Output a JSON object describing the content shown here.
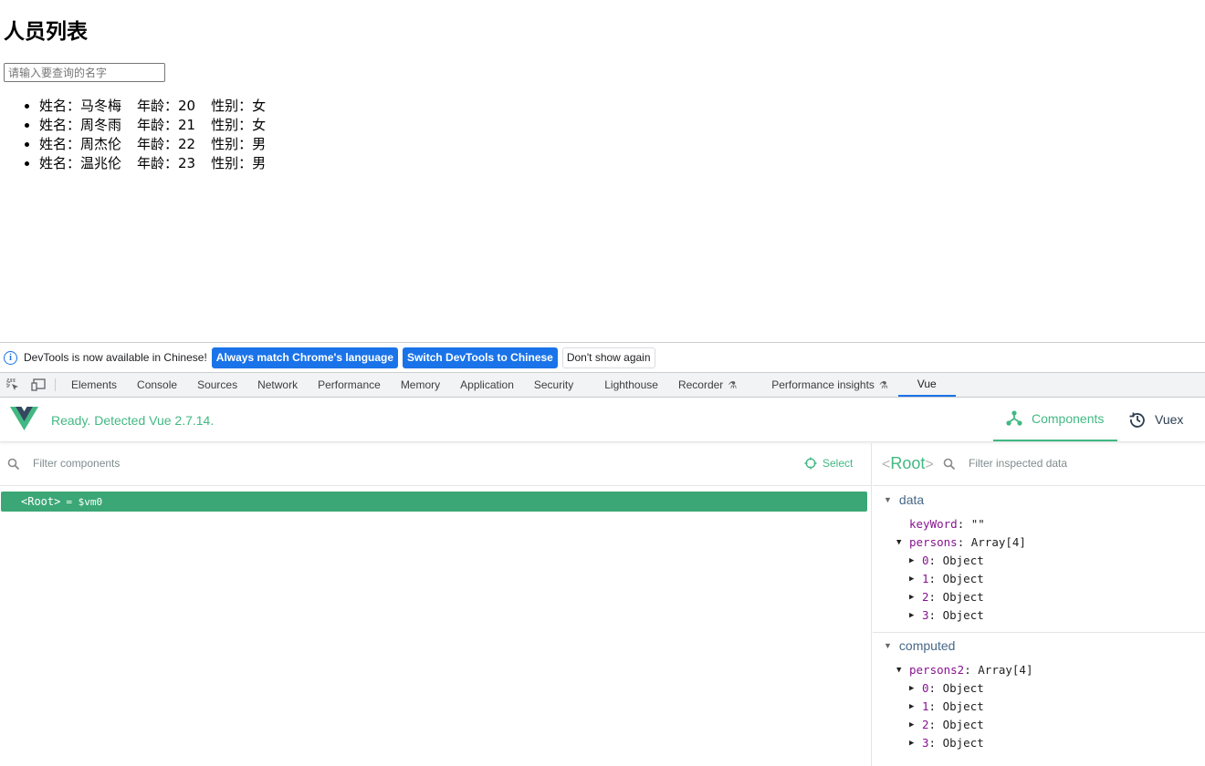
{
  "page": {
    "title": "人员列表",
    "search_placeholder": "请输入要查询的名字",
    "persons": [
      {
        "name": "姓名：马冬梅",
        "age": "年龄：20",
        "sex": "性别：女"
      },
      {
        "name": "姓名：周冬雨",
        "age": "年龄：21",
        "sex": "性别：女"
      },
      {
        "name": "姓名：周杰伦",
        "age": "年龄：22",
        "sex": "性别：男"
      },
      {
        "name": "姓名：温兆伦",
        "age": "年龄：23",
        "sex": "性别：男"
      }
    ]
  },
  "infobar": {
    "message": "DevTools is now available in Chinese!",
    "btn_match": "Always match Chrome's language",
    "btn_switch": "Switch DevTools to Chinese",
    "btn_dismiss": "Don't show again"
  },
  "tabs": [
    {
      "label": "Elements"
    },
    {
      "label": "Console"
    },
    {
      "label": "Sources"
    },
    {
      "label": "Network"
    },
    {
      "label": "Performance"
    },
    {
      "label": "Memory"
    },
    {
      "label": "Application"
    },
    {
      "label": "Security"
    },
    {
      "label": "Lighthouse"
    },
    {
      "label": "Recorder"
    },
    {
      "label": "Performance insights"
    },
    {
      "label": "Vue"
    }
  ],
  "vue": {
    "status": "Ready. Detected Vue 2.7.14.",
    "nav_components": "Components",
    "nav_vuex": "Vuex",
    "accent_color": "#42b883",
    "filter_components_placeholder": "Filter components",
    "select_label": "Select",
    "root_component": "<Root>",
    "root_vm": "= $vm0",
    "inspected_title": "Root",
    "filter_inspected_placeholder": "Filter inspected data",
    "data_section": {
      "label": "data",
      "keyword_key": "keyWord",
      "keyword_value": "\"\"",
      "persons_key": "persons",
      "persons_value": "Array[4]",
      "items": [
        {
          "key": "0",
          "value": "Object"
        },
        {
          "key": "1",
          "value": "Object"
        },
        {
          "key": "2",
          "value": "Object"
        },
        {
          "key": "3",
          "value": "Object"
        }
      ]
    },
    "computed_section": {
      "label": "computed",
      "persons2_key": "persons2",
      "persons2_value": "Array[4]",
      "items": [
        {
          "key": "0",
          "value": "Object"
        },
        {
          "key": "1",
          "value": "Object"
        },
        {
          "key": "2",
          "value": "Object"
        },
        {
          "key": "3",
          "value": "Object"
        }
      ]
    }
  }
}
